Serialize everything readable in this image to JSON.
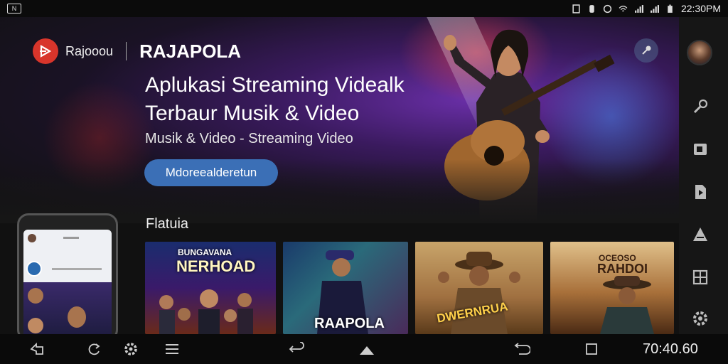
{
  "statusbar": {
    "time": "22:30PM",
    "left_icon": "n-notification-icon",
    "icons": [
      "sim-icon",
      "sync-icon",
      "alarm-icon",
      "wifi-icon",
      "signal-icon",
      "signal-icon",
      "battery-icon"
    ]
  },
  "header": {
    "brand_name": "Rajooou",
    "app_title": "RAJAPOLA"
  },
  "hero": {
    "headline_line1": "Aplukasi Streaming Videalk",
    "headline_line2": "Terbaur Musik & Video",
    "subtitle": "Musik & Video - Streaming Video",
    "cta_label": "Mdoreealderetun"
  },
  "featured": {
    "title": "Flatuia",
    "cards": [
      {
        "title_top": "BUNGAVANA",
        "title_main": "NERHOAD"
      },
      {
        "title_main": "RAAPOLA"
      },
      {
        "title_main": "DWERNRUA"
      },
      {
        "title_top": "OCEOSO",
        "title_main": "RAHDOI"
      }
    ]
  },
  "rail": {
    "icons": [
      "microphone-icon",
      "library-icon",
      "document-play-icon",
      "artist-icon",
      "grid-icon",
      "settings-icon"
    ]
  },
  "navbar": {
    "time": "70:40.60",
    "buttons": [
      "back-icon",
      "refresh-icon",
      "settings-icon",
      "menu-icon",
      "return-icon",
      "home-icon",
      "undo-icon",
      "recents-icon"
    ]
  },
  "colors": {
    "accent": "#3b6fb6",
    "brand": "#d8352b",
    "background": "#111111"
  }
}
